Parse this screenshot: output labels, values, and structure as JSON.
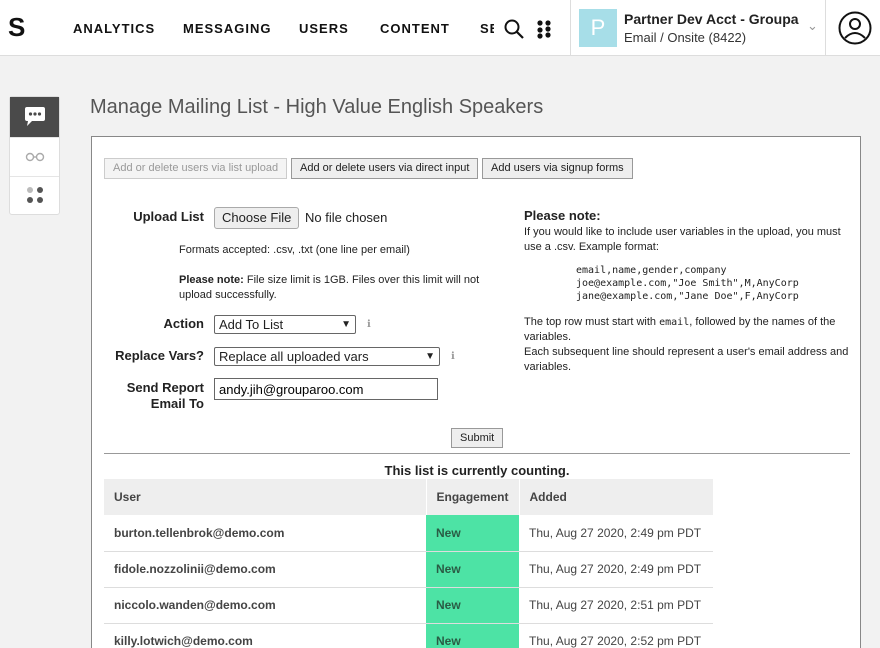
{
  "nav": {
    "logo": "S",
    "items": [
      "ANALYTICS",
      "MESSAGING",
      "USERS",
      "CONTENT",
      "SE"
    ]
  },
  "account": {
    "initial": "P",
    "name": "Partner Dev Acct - Groupa",
    "subtitle": "Email / Onsite (8422)"
  },
  "page": {
    "title": "Manage Mailing List - High Value English Speakers"
  },
  "tabs": [
    "Add or delete users via list upload",
    "Add or delete users via direct input",
    "Add users via signup forms"
  ],
  "form": {
    "upload_label": "Upload List",
    "choose_file": "Choose File",
    "no_file": "No file chosen",
    "formats": "Formats accepted: .csv, .txt (one line per email)",
    "size_note_bold": "Please note:",
    "size_note_1": "File size limit is 1GB. Files over this limit will not",
    "size_note_2": "upload successfully.",
    "action_label": "Action",
    "action_value": "Add To List",
    "replace_label": "Replace Vars?",
    "replace_value": "Replace all uploaded vars",
    "report_label_1": "Send Report",
    "report_label_2": "Email To",
    "report_email": "andy.jih@grouparoo.com",
    "submit": "Submit"
  },
  "note": {
    "heading": "Please note:",
    "line1": "If you would like to include user variables in the upload, you must",
    "line2": "use a .csv. Example format:",
    "code": "email,name,gender,company\njoe@example.com,\"Joe Smith\",M,AnyCorp\njane@example.com,\"Jane Doe\",F,AnyCorp",
    "after1_a": "The top row must start with ",
    "after1_code": "email",
    "after1_b": ", followed by the names of the",
    "after2": "variables.",
    "after3": "Each subsequent line should represent a user's email address and",
    "after4": "variables."
  },
  "list": {
    "status": "This list is currently counting.",
    "headers": [
      "User",
      "Engagement",
      "Added"
    ],
    "rows": [
      [
        "burton.tellenbrok@demo.com",
        "New",
        "Thu, Aug 27 2020, 2:49 pm PDT"
      ],
      [
        "fidole.nozzolinii@demo.com",
        "New",
        "Thu, Aug 27 2020, 2:49 pm PDT"
      ],
      [
        "niccolo.wanden@demo.com",
        "New",
        "Thu, Aug 27 2020, 2:51 pm PDT"
      ],
      [
        "killy.lotwich@demo.com",
        "New",
        "Thu, Aug 27 2020, 2:52 pm PDT"
      ]
    ]
  }
}
